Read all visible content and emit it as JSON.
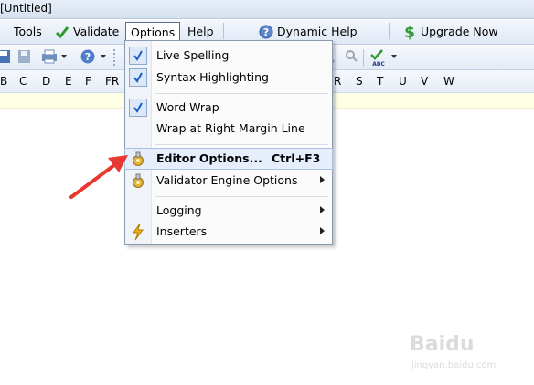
{
  "window": {
    "title": "[Untitled]"
  },
  "menubar": {
    "items": [
      {
        "id": "tools",
        "label": "Tools"
      },
      {
        "id": "validate",
        "label": "Validate",
        "icon": "check-icon"
      },
      {
        "id": "options",
        "label": "Options"
      },
      {
        "id": "help",
        "label": "Help"
      },
      {
        "id": "dynamic-help",
        "label": "Dynamic Help",
        "icon": "question-icon"
      },
      {
        "id": "upgrade",
        "label": "Upgrade Now",
        "icon": "dollar-icon"
      }
    ]
  },
  "letters": [
    "B",
    "C",
    "D",
    "E",
    "F",
    "FR",
    "R",
    "S",
    "T",
    "U",
    "V",
    "W"
  ],
  "options_menu": {
    "items": [
      {
        "label": "Live Spelling",
        "checked": true
      },
      {
        "label": "Syntax Highlighting",
        "checked": true
      },
      {
        "label": "Word Wrap",
        "checked": true
      },
      {
        "label": "Wrap at Right Margin Line",
        "checked": false
      },
      {
        "label": "Editor Options...",
        "shortcut": "Ctrl+F3",
        "icon": "gear-icon",
        "highlighted": true
      },
      {
        "label": "Validator Engine Options",
        "icon": "gear-icon",
        "submenu": true
      },
      {
        "label": "Logging",
        "submenu": true
      },
      {
        "label": "Inserters",
        "icon": "lightning-icon",
        "submenu": true
      }
    ]
  },
  "watermark": {
    "brand": "Baidu",
    "site": "jingyan.baidu.com"
  },
  "colors": {
    "accent_check": "#1a5fc8",
    "annotation_arrow": "#e8382f",
    "dollar_green": "#2f9a2f"
  }
}
